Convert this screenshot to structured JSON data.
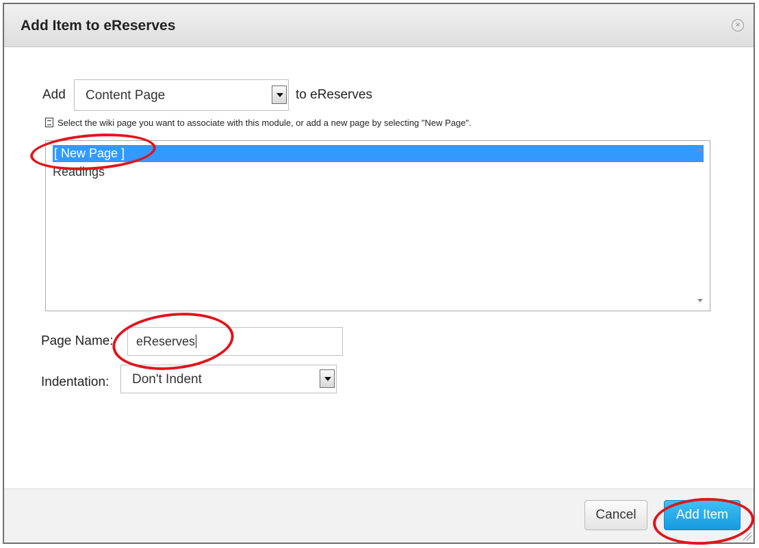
{
  "dialog": {
    "title": "Add Item to eReserves",
    "close_icon": "close-icon"
  },
  "add_row": {
    "prefix": "Add",
    "selected_type": "Content Page",
    "suffix": "to eReserves"
  },
  "hint": {
    "icon": "document-icon",
    "text": "Select the wiki page you want to associate with this module, or add a new page by selecting \"New Page\"."
  },
  "page_list": {
    "items": [
      {
        "label": "[ New Page ]",
        "selected": true
      },
      {
        "label": "Readings",
        "selected": false
      }
    ]
  },
  "page_name": {
    "label": "Page Name:",
    "value": "eReserves"
  },
  "indentation": {
    "label": "Indentation:",
    "value": "Don't Indent"
  },
  "footer": {
    "cancel_label": "Cancel",
    "add_label": "Add Item"
  },
  "colors": {
    "selection": "#3399ff",
    "primary_button": "#1aa7ea",
    "annotation": "#e0141d"
  }
}
